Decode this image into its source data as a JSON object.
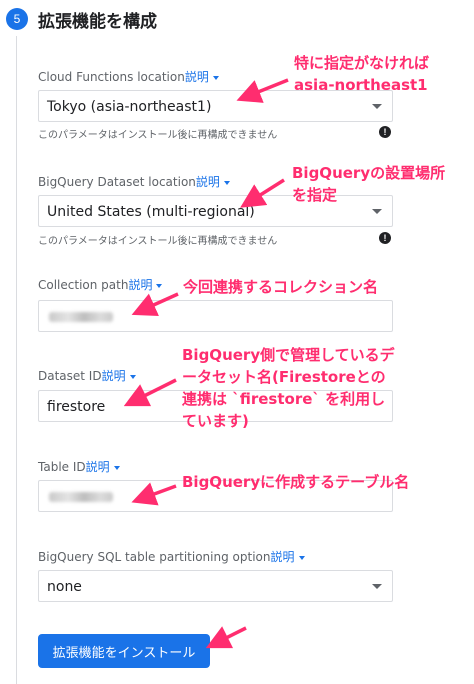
{
  "step": {
    "number": "5",
    "title": "拡張機能を構成"
  },
  "fields": {
    "cloud_functions_location": {
      "label": "Cloud Functions location",
      "help": "説明",
      "value": "Tokyo (asia-northeast1)",
      "hint": "このパラメータはインストール後に再構成できません"
    },
    "bigquery_dataset_location": {
      "label": "BigQuery Dataset location",
      "help": "説明",
      "value": "United States (multi-regional)",
      "hint": "このパラメータはインストール後に再構成できません"
    },
    "collection_path": {
      "label": "Collection path",
      "help": "説明"
    },
    "dataset_id": {
      "label": "Dataset ID",
      "help": "説明",
      "value": "firestore"
    },
    "table_id": {
      "label": "Table ID",
      "help": "説明"
    },
    "partitioning": {
      "label": "BigQuery SQL table partitioning option",
      "help": "説明",
      "value": "none"
    }
  },
  "info_icon": "!",
  "install_button": "拡張機能をインストール",
  "annotations": {
    "location": "特に指定がなければ\nasia-northeast1",
    "dataset_location": "BigQueryの設置場所\nを指定",
    "collection": "今回連携するコレクション名",
    "dataset_id": "BigQuery側で管理しているデ\nータセット名(Firestoreとの\n連携は `firestore` を利用し\nています)",
    "table_id": "BigQueryに作成するテーブル名"
  },
  "colors": {
    "accent": "#1a73e8",
    "annotation": "#ff2d6f",
    "border": "#dadce0"
  }
}
